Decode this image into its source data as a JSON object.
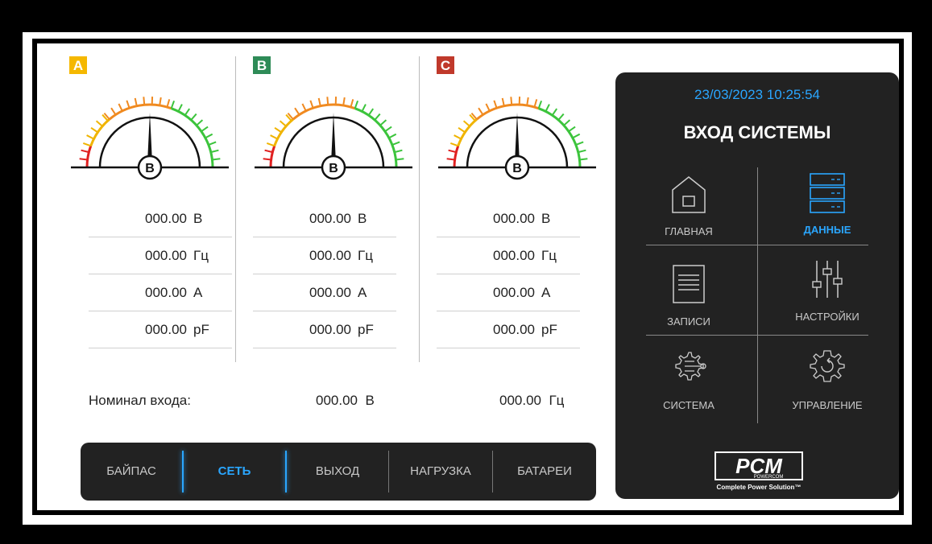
{
  "phases": [
    {
      "badge": "A",
      "color": "#f5b800",
      "gauge_label": "B",
      "rows": [
        {
          "value": "000.00",
          "unit": "В"
        },
        {
          "value": "000.00",
          "unit": "Гц"
        },
        {
          "value": "000.00",
          "unit": "А"
        },
        {
          "value": "000.00",
          "unit": "pF"
        }
      ]
    },
    {
      "badge": "B",
      "color": "#2e8b57",
      "gauge_label": "B",
      "rows": [
        {
          "value": "000.00",
          "unit": "В"
        },
        {
          "value": "000.00",
          "unit": "Гц"
        },
        {
          "value": "000.00",
          "unit": "А"
        },
        {
          "value": "000.00",
          "unit": "pF"
        }
      ]
    },
    {
      "badge": "C",
      "color": "#c0392b",
      "gauge_label": "B",
      "rows": [
        {
          "value": "000.00",
          "unit": "В"
        },
        {
          "value": "000.00",
          "unit": "Гц"
        },
        {
          "value": "000.00",
          "unit": "А"
        },
        {
          "value": "000.00",
          "unit": "pF"
        }
      ]
    }
  ],
  "nominal": {
    "label": "Номинал входа:",
    "voltage": "000.00",
    "voltage_unit": "В",
    "freq": "000.00",
    "freq_unit": "Гц"
  },
  "tabs": [
    {
      "label": "БАЙПАС"
    },
    {
      "label": "СЕТЬ",
      "active": true
    },
    {
      "label": "ВЫХОД"
    },
    {
      "label": "НАГРУЗКА"
    },
    {
      "label": "БАТАРЕИ"
    }
  ],
  "panel": {
    "datetime": "23/03/2023 10:25:54",
    "title": "ВХОД СИСТЕМЫ",
    "menu": [
      {
        "label": "ГЛАВНАЯ",
        "icon": "home-icon"
      },
      {
        "label": "ДАННЫЕ",
        "icon": "server-icon",
        "active": true
      },
      {
        "label": "ЗАПИСИ",
        "icon": "records-icon"
      },
      {
        "label": "НАСТРОЙКИ",
        "icon": "sliders-icon"
      },
      {
        "label": "СИСТЕМА",
        "icon": "system-gear-icon"
      },
      {
        "label": "УПРАВЛЕНИЕ",
        "icon": "control-gear-icon"
      }
    ],
    "logo": {
      "brand": "PCM",
      "sub": "POWERCOM",
      "tagline": "Complete Power Solution™"
    }
  },
  "colors": {
    "accent": "#2aa6ff",
    "panel": "#222222"
  }
}
